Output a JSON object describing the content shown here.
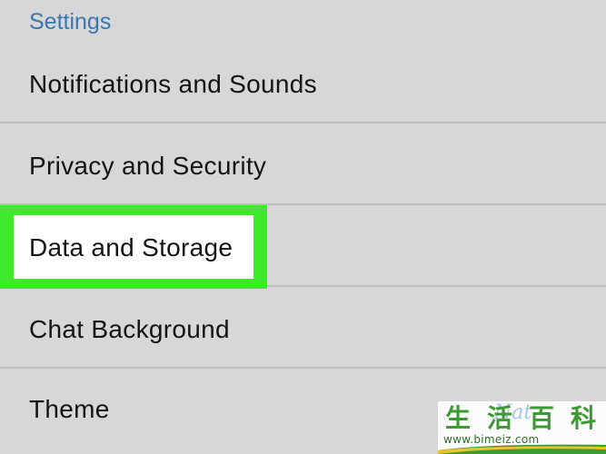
{
  "settings": {
    "section_title": "Settings",
    "items": [
      {
        "label": "Notifications and Sounds",
        "highlighted": false
      },
      {
        "label": "Privacy and Security",
        "highlighted": false
      },
      {
        "label": "Data and Storage",
        "highlighted": true
      },
      {
        "label": "Chat Background",
        "highlighted": false
      },
      {
        "label": "Theme",
        "highlighted": false
      }
    ]
  },
  "colors": {
    "background": "#d7d7d7",
    "section_title": "#3a76b0",
    "highlight_border": "#3fe82a",
    "divider": "#bdbdbd"
  },
  "watermark": {
    "chars": [
      "生",
      "活",
      "百",
      "科"
    ],
    "url": "www.bimeiz.com",
    "overlay_text": "Nat"
  }
}
